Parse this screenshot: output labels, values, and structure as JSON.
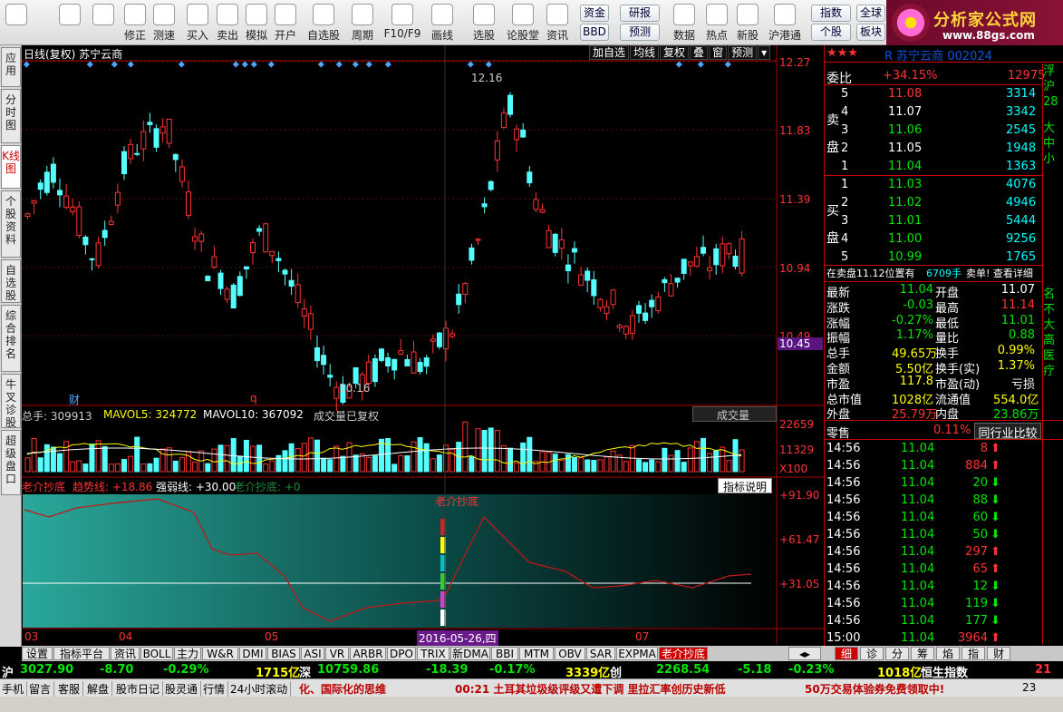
{
  "toolbar": {
    "buttons": [
      {
        "label": "",
        "icon": "home-icon"
      },
      {
        "label": "",
        "icon": "back-icon"
      },
      {
        "label": "",
        "icon": "updown-icon"
      },
      {
        "label": "修正",
        "icon": "repair-icon"
      },
      {
        "label": "测速",
        "icon": "clock-icon"
      },
      {
        "label": "买入",
        "icon": "buy-icon"
      },
      {
        "label": "卖出",
        "icon": "sell-icon"
      },
      {
        "label": "模拟",
        "icon": "hammer-icon"
      },
      {
        "label": "开户",
        "icon": "lock-icon"
      },
      {
        "label": "自选股",
        "icon": "star-icon"
      },
      {
        "label": "周期",
        "icon": "cycle-icon"
      },
      {
        "label": "F10/F9",
        "icon": "f10-icon"
      },
      {
        "label": "画线",
        "icon": "pen-icon"
      },
      {
        "label": "选股",
        "icon": "select-icon"
      },
      {
        "label": "论股堂",
        "icon": "forum-icon"
      },
      {
        "label": "资讯",
        "icon": "news-icon"
      },
      {
        "label": "数据",
        "icon": "pe-icon"
      },
      {
        "label": "热点",
        "icon": "hot-icon"
      },
      {
        "label": "新股",
        "icon": "newstock-icon"
      },
      {
        "label": "沪港通",
        "icon": "hk-icon"
      }
    ],
    "small": [
      "资金",
      "研报",
      "BBD",
      "预测",
      "指数",
      "个股",
      "全球",
      "板块"
    ]
  },
  "logo": {
    "title": "分析家公式网",
    "url": "www.88gs.com"
  },
  "vtabs": [
    "应用",
    "分时图",
    "K线图",
    "个股资料",
    "自选股",
    "综合排名",
    "牛叉诊股",
    "超级盘口"
  ],
  "chart": {
    "title": "日线(复权)  苏宁云商",
    "top_buttons": [
      "加自选",
      "均线",
      "复权",
      "叠",
      "窗",
      "预测"
    ],
    "price_axis": [
      "12.27",
      "11.83",
      "11.39",
      "10.94",
      "10.49"
    ],
    "current_price": "10.45",
    "high_label": "12.16",
    "low_label": "10.16",
    "marker_cai": "财",
    "marker_q": "q",
    "volume_header": {
      "total": "总手: 309913",
      "mavol5": "MAVOL5: 324772",
      "mavol10": "MAVOL10: 367092",
      "note": "成交量已复权",
      "dropdown": "成交量"
    },
    "volume_axis": [
      "22659",
      "11329",
      "X100"
    ],
    "indicator_header": {
      "name": "老介抄底",
      "trend": "趋势线: +18.86",
      "strong": "强弱线: +30.00",
      "bottom": "老介抄底: +0",
      "explain": "指标说明"
    },
    "indicator_label": "老介抄底",
    "indicator_axis": [
      "+91.90",
      "+61.47",
      "+31.05"
    ],
    "x_axis": [
      "03",
      "04",
      "05",
      "2016-05-26,四",
      "07"
    ]
  },
  "quote": {
    "stock": "R  苏宁云商  002024",
    "weibi_label": "委比",
    "weibi": "+34.15%",
    "weicha": "12975",
    "sell": [
      {
        "n": "5",
        "p": "11.08",
        "v": "3314"
      },
      {
        "n": "4",
        "p": "11.07",
        "v": "3342"
      },
      {
        "n": "3",
        "p": "11.06",
        "v": "2545"
      },
      {
        "n": "2",
        "p": "11.05",
        "v": "1948"
      },
      {
        "n": "1",
        "p": "11.04",
        "v": "1363"
      }
    ],
    "buy": [
      {
        "n": "1",
        "p": "11.03",
        "v": "4076"
      },
      {
        "n": "2",
        "p": "11.02",
        "v": "4946"
      },
      {
        "n": "3",
        "p": "11.01",
        "v": "5444"
      },
      {
        "n": "4",
        "p": "11.00",
        "v": "9256"
      },
      {
        "n": "5",
        "p": "10.99",
        "v": "1765"
      }
    ],
    "sell_label": "卖盘",
    "buy_label": "买盘",
    "info_line": "在卖盘11.12位置有",
    "info_vol": "6709手",
    "info_tail": "卖单!  查看详细",
    "stats": [
      {
        "k": "最新",
        "v": "11.04",
        "k2": "开盘",
        "v2": "11.07"
      },
      {
        "k": "涨跌",
        "v": "-0.03",
        "k2": "最高",
        "v2": "11.14"
      },
      {
        "k": "涨幅",
        "v": "-0.27%",
        "k2": "最低",
        "v2": "11.01"
      },
      {
        "k": "振幅",
        "v": "1.17%",
        "k2": "量比",
        "v2": "0.88"
      },
      {
        "k": "总手",
        "v": "49.65万",
        "k2": "换手",
        "v2": "0.99%"
      },
      {
        "k": "金额",
        "v": "5.50亿",
        "k2": "换手(实)",
        "v2": "1.37%"
      },
      {
        "k": "市盈",
        "v": "117.8",
        "k2": "市盈(动)",
        "v2": "亏损"
      },
      {
        "k": "总市值",
        "v": "1028亿",
        "k2": "流通值",
        "v2": "554.0亿"
      },
      {
        "k": "外盘",
        "v": "25.79万",
        "k2": "内盘",
        "v2": "23.86万"
      }
    ],
    "sector": "零售",
    "sector_pct": "0.11%",
    "sector_btn": "同行业比较",
    "ticks": [
      {
        "t": "14:56",
        "p": "11.04",
        "v": "8",
        "d": "up",
        "x": "3"
      },
      {
        "t": "14:56",
        "p": "11.04",
        "v": "884",
        "d": "up",
        "x": "26"
      },
      {
        "t": "14:56",
        "p": "11.04",
        "v": "20",
        "d": "down",
        "x": "3"
      },
      {
        "t": "14:56",
        "p": "11.04",
        "v": "88",
        "d": "down",
        "x": "5"
      },
      {
        "t": "14:56",
        "p": "11.04",
        "v": "60",
        "d": "down",
        "x": "8"
      },
      {
        "t": "14:56",
        "p": "11.04",
        "v": "50",
        "d": "down",
        "x": "5"
      },
      {
        "t": "14:56",
        "p": "11.04",
        "v": "297",
        "d": "up",
        "x": "20"
      },
      {
        "t": "14:56",
        "p": "11.04",
        "v": "65",
        "d": "up",
        "x": "6"
      },
      {
        "t": "14:56",
        "p": "11.04",
        "v": "12",
        "d": "down",
        "x": "3"
      },
      {
        "t": "14:56",
        "p": "11.04",
        "v": "119",
        "d": "down",
        "x": "11"
      },
      {
        "t": "14:56",
        "p": "11.04",
        "v": "177",
        "d": "down",
        "x": "6"
      },
      {
        "t": "15:00",
        "p": "11.04",
        "v": "3964",
        "d": "up",
        "x": "280"
      }
    ],
    "edge": [
      "浮",
      "沪",
      "28",
      "",
      "大中小",
      "",
      "",
      "",
      "",
      "",
      "",
      "",
      "",
      "",
      "",
      "",
      "名不大高医疗"
    ]
  },
  "bottom_tabs": [
    "设置",
    "指标平台",
    "资讯",
    "BOLL",
    "主力",
    "W&R",
    "DMI",
    "BIAS",
    "ASI",
    "VR",
    "ARBR",
    "DPO",
    "TRIX",
    "新DMA",
    "BBI",
    "MTM",
    "OBV",
    "SAR",
    "EXPMA",
    "老介抄底"
  ],
  "right_tabs": [
    "细",
    "诊",
    "分",
    "筹",
    "焰",
    "指",
    "财"
  ],
  "index_bar": {
    "sh_label": "沪",
    "sh_val": "3027.90",
    "sh_chg": "-8.70",
    "sh_pct": "-0.29%",
    "sh_amt": "1715亿",
    "sz_label": "深",
    "sz_val": "10759.86",
    "sz_chg": "-18.39",
    "sz_pct": "-0.17%",
    "sz_amt": "3339亿",
    "cy_label": "创",
    "cy_val": "2268.54",
    "cy_chg": "-5.18",
    "cy_pct": "-0.23%",
    "cy_amt": "1018亿",
    "tail": "恒生指数",
    "tail2": "21"
  },
  "status": {
    "items": [
      "手机",
      "留言",
      "客服",
      "解盘",
      "股市日记",
      "股灵通",
      "行情",
      "24小时滚动"
    ],
    "news1": "化、国际化的思维",
    "news2": "00:21 土耳其垃圾级评级又遭下调 里拉汇率创历史新低",
    "promo": "50万交易体验券免费领取中!",
    "tail": "23"
  }
}
